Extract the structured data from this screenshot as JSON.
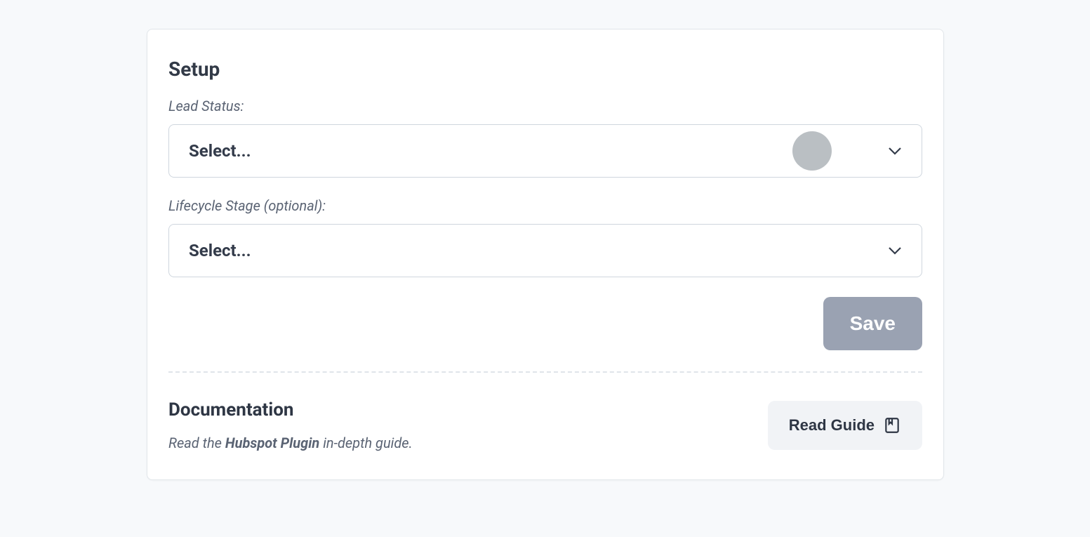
{
  "setup": {
    "title": "Setup",
    "leadStatus": {
      "label": "Lead Status:",
      "value": "Select..."
    },
    "lifecycleStage": {
      "label": "Lifecycle Stage (optional):",
      "value": "Select..."
    },
    "save_label": "Save"
  },
  "documentation": {
    "title": "Documentation",
    "desc_prefix": "Read the ",
    "desc_bold": "Hubspot Plugin",
    "desc_suffix": " in-depth guide.",
    "read_guide_label": "Read Guide"
  }
}
